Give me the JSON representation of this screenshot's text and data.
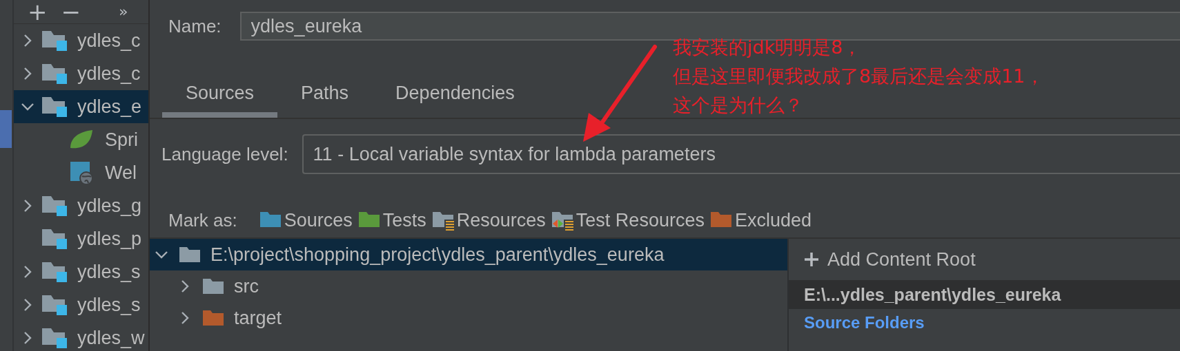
{
  "toolbar": {
    "add": "+",
    "remove": "−",
    "more": "»"
  },
  "modules": [
    {
      "name": "ydles_c",
      "kind": "module",
      "expandable": true,
      "expanded": false,
      "selected": false
    },
    {
      "name": "ydles_c",
      "kind": "module",
      "expandable": true,
      "expanded": false,
      "selected": false
    },
    {
      "name": "ydles_e",
      "kind": "module",
      "expandable": true,
      "expanded": true,
      "selected": true,
      "children": [
        {
          "name": "Spri",
          "kind": "spring",
          "selected": false
        },
        {
          "name": "Wel",
          "kind": "web",
          "selected": false
        }
      ]
    },
    {
      "name": "ydles_g",
      "kind": "module",
      "expandable": true,
      "expanded": false,
      "selected": false
    },
    {
      "name": "ydles_p",
      "kind": "module",
      "expandable": false,
      "selected": false
    },
    {
      "name": "ydles_s",
      "kind": "module",
      "expandable": true,
      "expanded": false,
      "selected": false
    },
    {
      "name": "ydles_s",
      "kind": "module",
      "expandable": true,
      "expanded": false,
      "selected": false
    },
    {
      "name": "ydles_w",
      "kind": "module",
      "expandable": true,
      "expanded": false,
      "selected": false
    }
  ],
  "name_field": {
    "label": "Name:",
    "value": "ydles_eureka"
  },
  "tabs": [
    {
      "label": "Sources",
      "selected": true
    },
    {
      "label": "Paths",
      "selected": false
    },
    {
      "label": "Dependencies",
      "selected": false
    }
  ],
  "language_level": {
    "label": "Language level:",
    "value": "11 - Local variable syntax for lambda parameters"
  },
  "mark_as": {
    "label": "Mark as:",
    "items": [
      {
        "label": "Sources",
        "kind": "sources"
      },
      {
        "label": "Tests",
        "kind": "tests"
      },
      {
        "label": "Resources",
        "kind": "resources"
      },
      {
        "label": "Test Resources",
        "kind": "test_resources"
      },
      {
        "label": "Excluded",
        "kind": "excluded"
      }
    ]
  },
  "content_tree": [
    {
      "name": "E:\\project\\shopping_project\\ydles_parent\\ydles_eureka",
      "kind": "folder",
      "expanded": true,
      "selected": true,
      "children": [
        {
          "name": "src",
          "kind": "folder",
          "expanded": false,
          "selected": false
        },
        {
          "name": "target",
          "kind": "excluded",
          "expanded": false,
          "selected": false
        }
      ]
    }
  ],
  "content_roots": {
    "add_button": "Add Content Root",
    "root": "E:\\...ydles_parent\\ydles_eureka",
    "section": "Source Folders"
  },
  "annotation": {
    "lines": [
      "我安装的jdk明明是8，",
      "但是这里即便我改成了8最后还是会变成11，",
      "这个是为什么？"
    ]
  }
}
